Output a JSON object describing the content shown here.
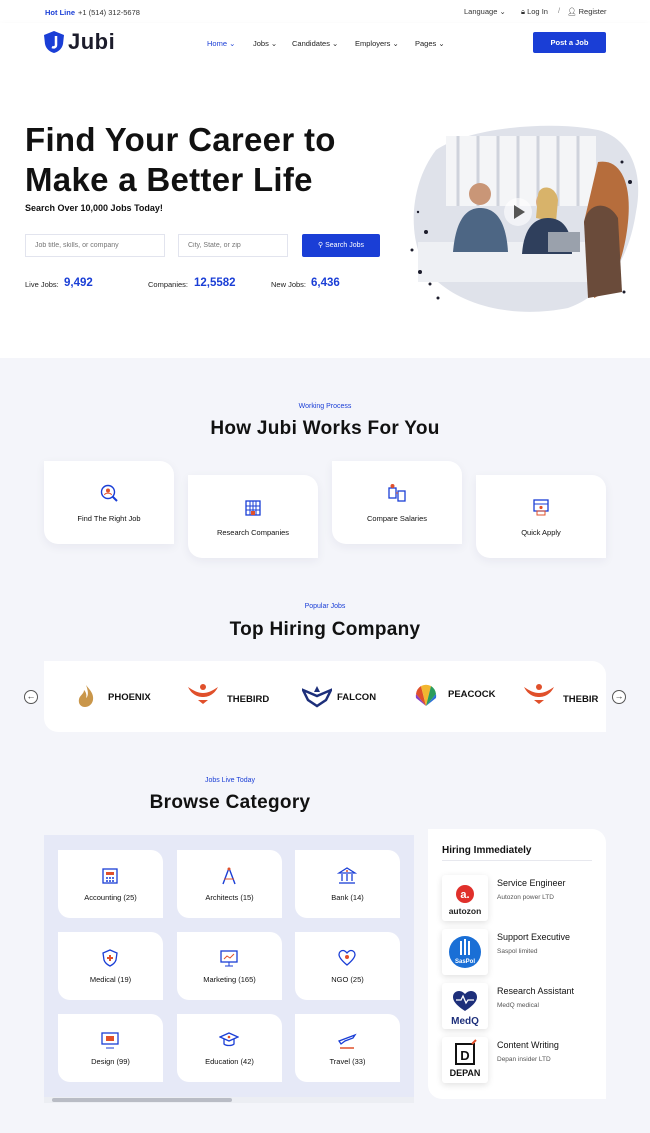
{
  "topbar": {
    "hotline_label": "Hot Line",
    "phone": "+1 (514) 312-5678",
    "language": "Language",
    "login": "Log In",
    "separator": "/",
    "register": "Register"
  },
  "nav": {
    "logo": "Jubi",
    "items": [
      "Home",
      "Jobs",
      "Candidates",
      "Employers",
      "Pages"
    ],
    "active": "Home",
    "post_button": "Post a Job"
  },
  "hero": {
    "title_line1": "Find Your Career to",
    "title_line2": "Make a Better Life",
    "subtitle": "Search Over 10,000 Jobs Today!",
    "keyword_placeholder": "Job title, skills, or company",
    "location_placeholder": "City, State, or zip",
    "search_button": "Search Jobs",
    "stats": [
      {
        "label": "Live Jobs:",
        "value": "9,492"
      },
      {
        "label": "Companies:",
        "value": "12,5582"
      },
      {
        "label": "New Jobs:",
        "value": "6,436"
      }
    ]
  },
  "process": {
    "kicker": "Working Process",
    "title": "How  Jubi Works For You",
    "cards": [
      {
        "label": "Find The Right Job",
        "icon": "search-person-icon"
      },
      {
        "label": "Research Companies",
        "icon": "building-icon"
      },
      {
        "label": "Compare Salaries",
        "icon": "salary-icon"
      },
      {
        "label": "Quick Apply",
        "icon": "apply-icon"
      }
    ]
  },
  "companies": {
    "kicker": "Popular Jobs",
    "title": "Top Hiring Company",
    "items": [
      {
        "name": "PHOENIX",
        "color": "#c9964a"
      },
      {
        "name": "THEBIRD",
        "color": "#e0502b"
      },
      {
        "name": "FALCON",
        "color": "#1d2f7a"
      },
      {
        "name": "PEACOCK",
        "color": "#2a9d5c"
      },
      {
        "name": "THEBIR",
        "color": "#e0502b"
      }
    ]
  },
  "categories": {
    "kicker": "Jobs Live Today",
    "title": "Browse Category",
    "items": [
      {
        "label": "Accounting (25)",
        "icon": "accounting-icon"
      },
      {
        "label": "Architects (15)",
        "icon": "architects-icon"
      },
      {
        "label": "Bank (14)",
        "icon": "bank-icon"
      },
      {
        "label": "Medical (19)",
        "icon": "medical-icon"
      },
      {
        "label": "Marketing (165)",
        "icon": "marketing-icon"
      },
      {
        "label": "NGO (25)",
        "icon": "ngo-icon"
      },
      {
        "label": "Design (99)",
        "icon": "design-icon"
      },
      {
        "label": "Education (42)",
        "icon": "education-icon"
      },
      {
        "label": "Travel (33)",
        "icon": "travel-icon"
      }
    ]
  },
  "hiring": {
    "title": "Hiring Immediately",
    "jobs": [
      {
        "title": "Service Engineer",
        "company": "Autozon power LTD",
        "logo": "autozon"
      },
      {
        "title": "Support Executive",
        "company": "Saspol limited",
        "logo": "SasPol"
      },
      {
        "title": "Research Assistant",
        "company": "MedQ medical",
        "logo": "MedQ"
      },
      {
        "title": "Content Writing",
        "company": "Depan insider LTD",
        "logo": "DEPAN"
      }
    ]
  },
  "colors": {
    "accent": "#1a3ed6",
    "background": "#f4f5fa"
  }
}
